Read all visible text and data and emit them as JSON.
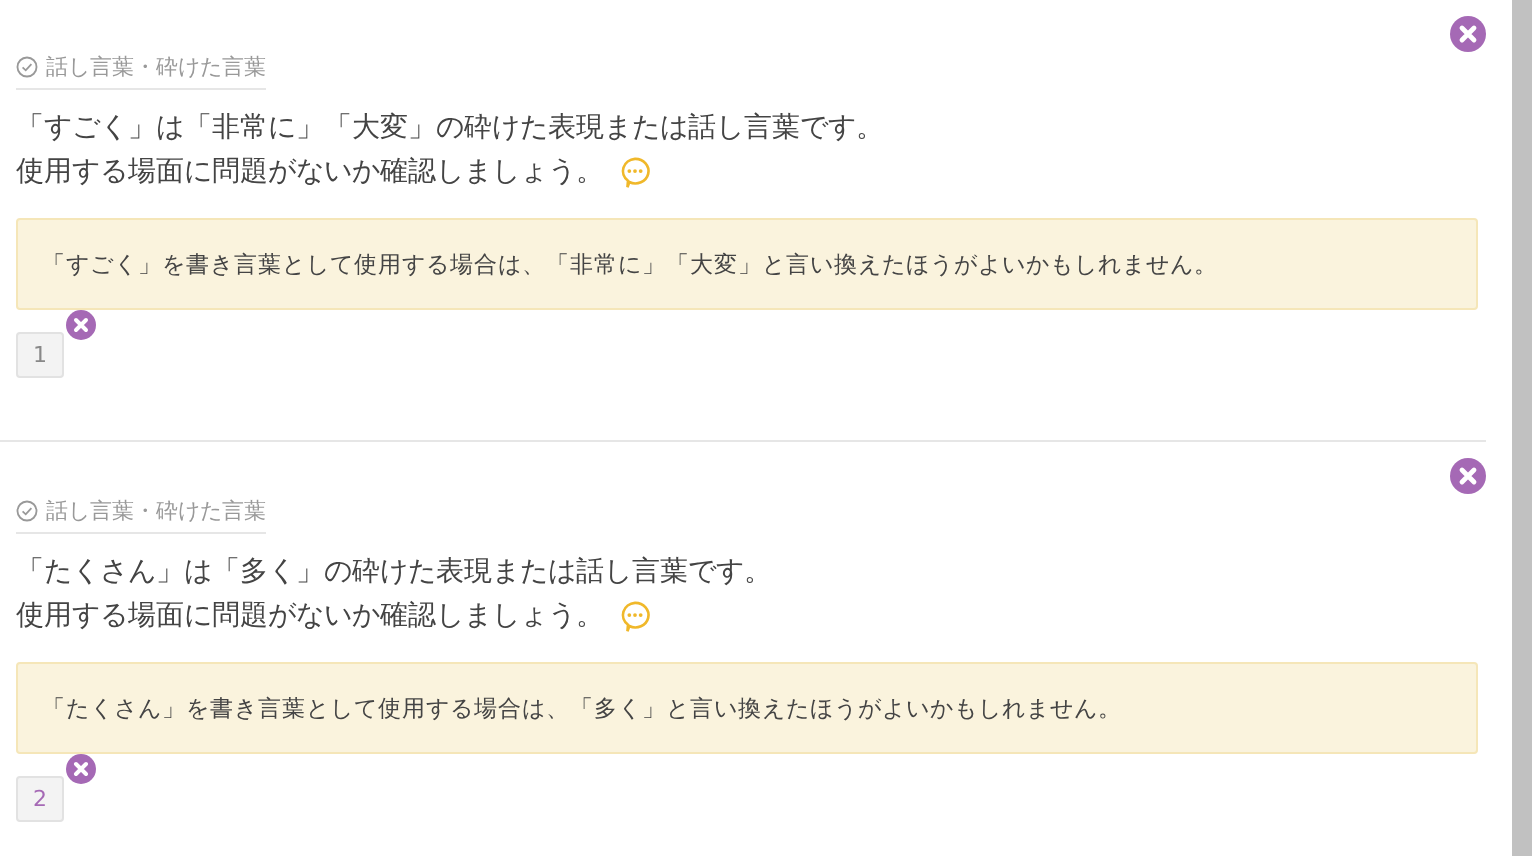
{
  "cards": [
    {
      "category": "話し言葉・砕けた言葉",
      "message": [
        "「すごく」は「非常に」「大変」の砕けた表現または話し言葉です。",
        "使用する場面に問題がないか確認しましょう。"
      ],
      "suggestion": "「すごく」を書き言葉として使用する場合は、「非常に」「大変」と言い換えたほうがよいかもしれません。",
      "number": "1",
      "selected": false
    },
    {
      "category": "話し言葉・砕けた言葉",
      "message": [
        "「たくさん」は「多く」の砕けた表現または話し言葉です。",
        "使用する場面に問題がないか確認しましょう。"
      ],
      "suggestion": "「たくさん」を書き言葉として使用する場合は、「多く」と言い換えたほうがよいかもしれません。",
      "number": "2",
      "selected": true
    }
  ]
}
